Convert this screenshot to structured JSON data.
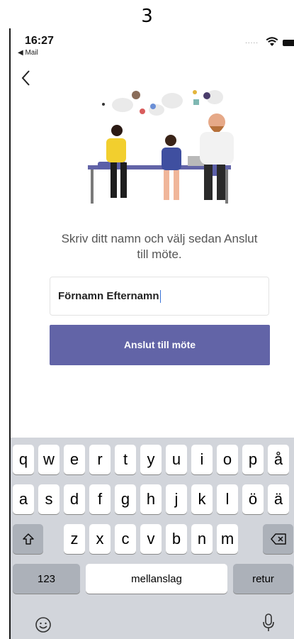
{
  "page_number": "3",
  "status_bar": {
    "time": "16:27",
    "back_app": "◀ Mail",
    "signal_dots": "....."
  },
  "prompt": {
    "line1": "Skriv ditt namn och välj sedan Anslut",
    "line2": "till möte."
  },
  "name_input": {
    "value": "Förnamn Efternamn"
  },
  "join_button": {
    "label": "Anslut till möte"
  },
  "colors": {
    "accent": "#6264a7",
    "keyboard_bg": "#d2d5db"
  },
  "keyboard": {
    "row1": [
      "q",
      "w",
      "e",
      "r",
      "t",
      "y",
      "u",
      "i",
      "o",
      "p",
      "å"
    ],
    "row2": [
      "a",
      "s",
      "d",
      "f",
      "g",
      "h",
      "j",
      "k",
      "l",
      "ö",
      "ä"
    ],
    "row3": [
      "z",
      "x",
      "c",
      "v",
      "b",
      "n",
      "m"
    ],
    "numbers_label": "123",
    "space_label": "mellanslag",
    "return_label": "retur"
  }
}
